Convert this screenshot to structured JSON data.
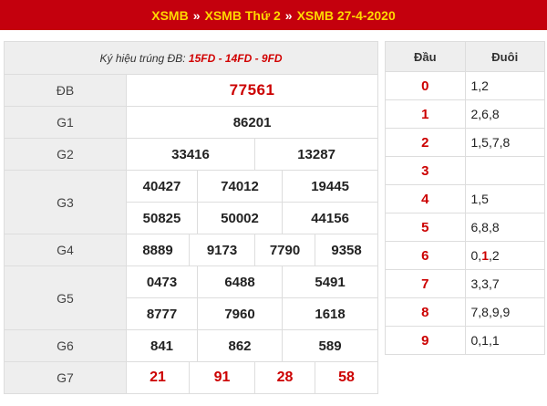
{
  "breadcrumb": {
    "items": [
      "XSMB",
      "XSMB Thứ 2",
      "XSMB 27-4-2020"
    ],
    "separator": "»"
  },
  "results": {
    "note_prefix": "Ký hiệu trúng ĐB: ",
    "note_codes": "15FD - 14FD - 9FD",
    "rows": [
      {
        "label": "ĐB",
        "values": [
          "77561"
        ]
      },
      {
        "label": "G1",
        "values": [
          "86201"
        ]
      },
      {
        "label": "G2",
        "values": [
          "33416",
          "13287"
        ]
      },
      {
        "label": "G3",
        "values": [
          "40427",
          "74012",
          "19445",
          "50825",
          "50002",
          "44156"
        ]
      },
      {
        "label": "G4",
        "values": [
          "8889",
          "9173",
          "7790",
          "9358"
        ]
      },
      {
        "label": "G5",
        "values": [
          "0473",
          "6488",
          "5491",
          "8777",
          "7960",
          "1618"
        ]
      },
      {
        "label": "G6",
        "values": [
          "841",
          "862",
          "589"
        ]
      },
      {
        "label": "G7",
        "values": [
          "21",
          "91",
          "28",
          "58"
        ]
      }
    ]
  },
  "dau_duoi": {
    "header_dau": "Đầu",
    "header_duoi": "Đuôi",
    "rows": [
      {
        "dau": "0",
        "duoi": "1,2"
      },
      {
        "dau": "1",
        "duoi": "2,6,8"
      },
      {
        "dau": "2",
        "duoi": "1,5,7,8"
      },
      {
        "dau": "3",
        "duoi": ""
      },
      {
        "dau": "4",
        "duoi": "1,5"
      },
      {
        "dau": "5",
        "duoi": "6,8,8"
      },
      {
        "dau": "6",
        "duoi_before": "0,",
        "duoi_highlight": "1",
        "duoi_after": ",2"
      },
      {
        "dau": "7",
        "duoi": "3,3,7"
      },
      {
        "dau": "8",
        "duoi": "7,8,9,9"
      },
      {
        "dau": "9",
        "duoi": "0,1,1"
      }
    ]
  },
  "colors": {
    "header_bg": "#c4000d",
    "breadcrumb_link": "#ffd800",
    "accent_red": "#cc0000",
    "label_bg": "#eeeeee"
  }
}
